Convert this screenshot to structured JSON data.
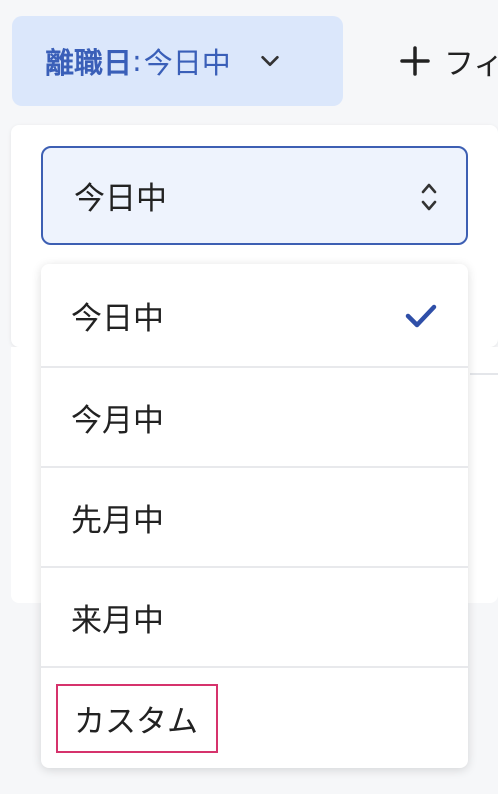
{
  "filter_chip": {
    "key": "離職日",
    "separator": ":",
    "value": "今日中"
  },
  "add_filter": {
    "label": "フィ"
  },
  "select": {
    "value": "今日中"
  },
  "menu": {
    "items": [
      {
        "label": "今日中",
        "selected": true
      },
      {
        "label": "今月中",
        "selected": false
      },
      {
        "label": "先月中",
        "selected": false
      },
      {
        "label": "来月中",
        "selected": false
      },
      {
        "label": "カスタム",
        "selected": false
      }
    ]
  },
  "colors": {
    "accent": "#3d5fb3",
    "chip_background": "#dbe7fb",
    "highlight_border": "#d6336c"
  }
}
